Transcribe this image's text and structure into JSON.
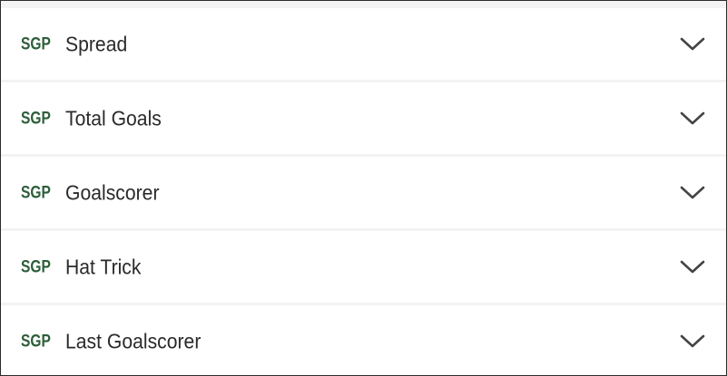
{
  "markets": [
    {
      "badge": "SGP",
      "label": "Spread",
      "icon": "chevron-down-icon",
      "expanded": false
    },
    {
      "badge": "SGP",
      "label": "Total Goals",
      "icon": "chevron-down-icon",
      "expanded": false
    },
    {
      "badge": "SGP",
      "label": "Goalscorer",
      "icon": "chevron-down-icon",
      "expanded": false
    },
    {
      "badge": "SGP",
      "label": "Hat Trick",
      "icon": "chevron-down-icon",
      "expanded": false
    },
    {
      "badge": "SGP",
      "label": "Last Goalscorer",
      "icon": "chevron-down-icon",
      "expanded": false
    }
  ],
  "colors": {
    "badge": "#2d5e3a",
    "label": "#2a2a2a",
    "chevron": "#444444",
    "row_background": "#ffffff",
    "separator": "#f3f3f3"
  }
}
